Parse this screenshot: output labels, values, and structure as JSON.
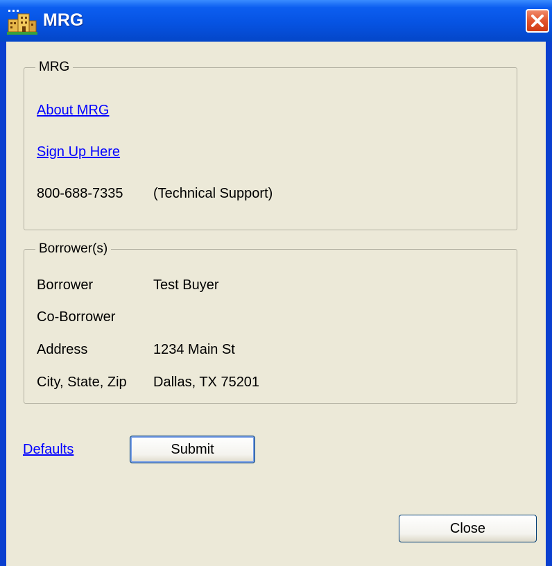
{
  "window": {
    "title": "MRG",
    "close_glyph": "✕",
    "app_icon": "buildings-icon"
  },
  "mrg_group": {
    "legend": "MRG",
    "about_link": "About MRG",
    "signup_link": "Sign Up Here",
    "phone": "800-688-7335",
    "phone_note": "(Technical Support)"
  },
  "borrowers_group": {
    "legend": "Borrower(s)",
    "rows": [
      {
        "label": "Borrower",
        "value": "Test Buyer"
      },
      {
        "label": "Co-Borrower",
        "value": ""
      },
      {
        "label": "Address",
        "value": "1234 Main St"
      },
      {
        "label": "City, State, Zip",
        "value": "Dallas, TX 75201"
      }
    ]
  },
  "actions": {
    "defaults_link": "Defaults",
    "submit_label": "Submit",
    "close_label": "Close"
  },
  "colors": {
    "titlebar": "#0653e2",
    "dialog_bg": "#ece9d8",
    "link": "#0000ff",
    "close_button": "#e2552d"
  }
}
